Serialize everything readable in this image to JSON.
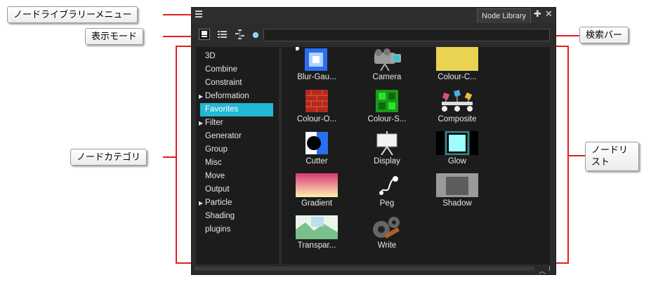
{
  "callouts": {
    "node_library_menu": "ノードライブラリーメニュー",
    "display_mode": "表示モード",
    "node_category": "ノードカテゴリ",
    "search_bar": "検索バー",
    "node_list": "ノードリスト"
  },
  "panel": {
    "tab_label": "Node Library",
    "add_glyph": "✚",
    "close_glyph": "✕",
    "search_placeholder": ""
  },
  "categories": [
    {
      "label": "3D",
      "expandable": false
    },
    {
      "label": "Combine",
      "expandable": false
    },
    {
      "label": "Constraint",
      "expandable": false
    },
    {
      "label": "Deformation",
      "expandable": true
    },
    {
      "label": "Favorites",
      "expandable": false,
      "selected": true
    },
    {
      "label": "Filter",
      "expandable": true
    },
    {
      "label": "Generator",
      "expandable": false
    },
    {
      "label": "Group",
      "expandable": false
    },
    {
      "label": "Misc",
      "expandable": false
    },
    {
      "label": "Move",
      "expandable": false
    },
    {
      "label": "Output",
      "expandable": false
    },
    {
      "label": "Particle",
      "expandable": true
    },
    {
      "label": "Shading",
      "expandable": false
    },
    {
      "label": "plugins",
      "expandable": false
    }
  ],
  "nodes": [
    {
      "label": "Blur-Gau...",
      "icon": "blur-icon"
    },
    {
      "label": "Camera",
      "icon": "camera-icon"
    },
    {
      "label": "Colour-C...",
      "icon": "colour-card-icon"
    },
    {
      "label": "Colour-O...",
      "icon": "colour-override-icon"
    },
    {
      "label": "Colour-S...",
      "icon": "colour-screen-icon"
    },
    {
      "label": "Composite",
      "icon": "composite-icon"
    },
    {
      "label": "Cutter",
      "icon": "cutter-icon"
    },
    {
      "label": "Display",
      "icon": "display-icon"
    },
    {
      "label": "Glow",
      "icon": "glow-icon"
    },
    {
      "label": "Gradient",
      "icon": "gradient-icon"
    },
    {
      "label": "Peg",
      "icon": "peg-icon"
    },
    {
      "label": "Shadow",
      "icon": "shadow-icon"
    },
    {
      "label": "Transpar...",
      "icon": "transparency-icon"
    },
    {
      "label": "Write",
      "icon": "write-icon"
    }
  ],
  "colors": {
    "accent": "#23b7d3",
    "callout_line": "#e0201c",
    "panel_bg": "#2c2c2c"
  }
}
